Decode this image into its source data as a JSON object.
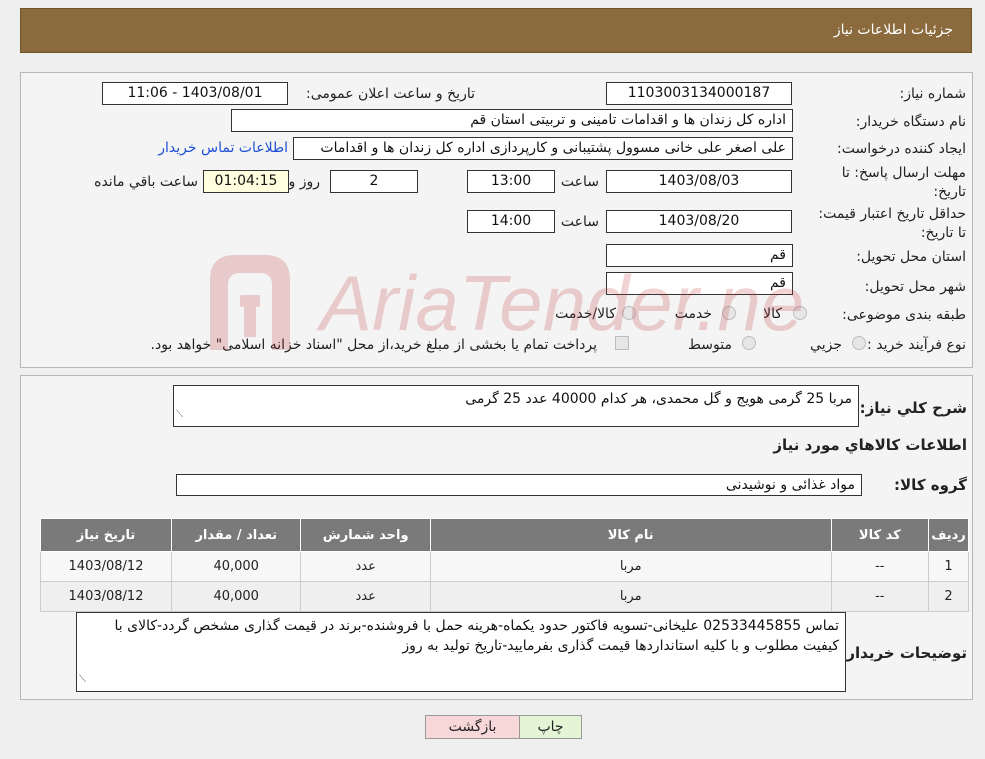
{
  "header": {
    "title": "جزئیات اطلاعات نیاز"
  },
  "form": {
    "need_number_label": "شماره نیاز:",
    "need_number": "1103003134000187",
    "announce_label": "تاریخ و ساعت اعلان عمومی:",
    "announce_value": "1403/08/01 - 11:06",
    "buyer_label": "نام دستگاه خریدار:",
    "buyer_value": "اداره کل زندان ها و اقدامات تامینی و تربیتی استان قم",
    "requester_label": "ایجاد کننده درخواست:",
    "requester_value": "علی اصغر علی خانی مسوول پشتیبانی و کارپردازی اداره کل زندان ها و اقدامات",
    "contact_link": "اطلاعات تماس خریدار",
    "deadline_label": "مهلت ارسال پاسخ: تا تاریخ:",
    "deadline_date": "1403/08/03",
    "time_label": "ساعت",
    "deadline_time": "13:00",
    "days_value": "2",
    "days_label": "روز و",
    "remaining_time": "01:04:15",
    "remaining_label": "ساعت باقي مانده",
    "validity_label": "حداقل تاریخ اعتبار قیمت: تا تاریخ:",
    "validity_date": "1403/08/20",
    "validity_time": "14:00",
    "province_label": "استان محل تحویل:",
    "province_value": "قم",
    "city_label": "شهر محل تحویل:",
    "city_value": "قم",
    "category_label": "طبقه بندی موضوعی:",
    "category_options": [
      "کالا",
      "خدمت",
      "کالا/خدمت"
    ],
    "process_label": "نوع فرآیند خرید :",
    "process_options": [
      "جزیي",
      "متوسط"
    ],
    "process_note": "پرداخت تمام یا بخشی از مبلغ خرید،از محل \"اسناد خزانه اسلامی\" خواهد بود."
  },
  "details": {
    "summary_label": "شرح کلي نياز:",
    "summary_value": "مربا 25 گرمی هویج و گل محمدی، هر کدام 40000 عدد 25 گرمی",
    "goods_title": "اطلاعات کالاهاي مورد نياز",
    "group_label": "گروه کالا:",
    "group_value": "مواد غذائی و نوشیدنی",
    "table": {
      "headers": [
        "رديف",
        "کد کالا",
        "نام کالا",
        "واحد شمارش",
        "تعداد / مقدار",
        "تاريخ نياز"
      ],
      "rows": [
        [
          "1",
          "--",
          "مربا",
          "عدد",
          "40,000",
          "1403/08/12"
        ],
        [
          "2",
          "--",
          "مربا",
          "عدد",
          "40,000",
          "1403/08/12"
        ]
      ]
    },
    "notes_label": "توضیحات خریدار:",
    "notes_value": "تماس 02533445855 علیخانی-تسویه فاکتور حدود یکماه-هرینه حمل با فروشنده-برند در قیمت گذاری مشخص گردد-کالای با کیفیت مطلوب و با کلیه استانداردها قیمت گذاری بفرمایید-تاریخ تولید به روز"
  },
  "buttons": {
    "print": "چاپ",
    "back": "بازگشت"
  },
  "watermark": {
    "text": "AriaTender.neT"
  },
  "colors": {
    "header_bg": "#8b6b3d",
    "table_header_bg": "#7a7a7a",
    "link": "#1d4fd6",
    "back_btn": "#f7d7d7",
    "print_btn": "#e3f5d5",
    "remaining_bg": "#ffffe0"
  }
}
